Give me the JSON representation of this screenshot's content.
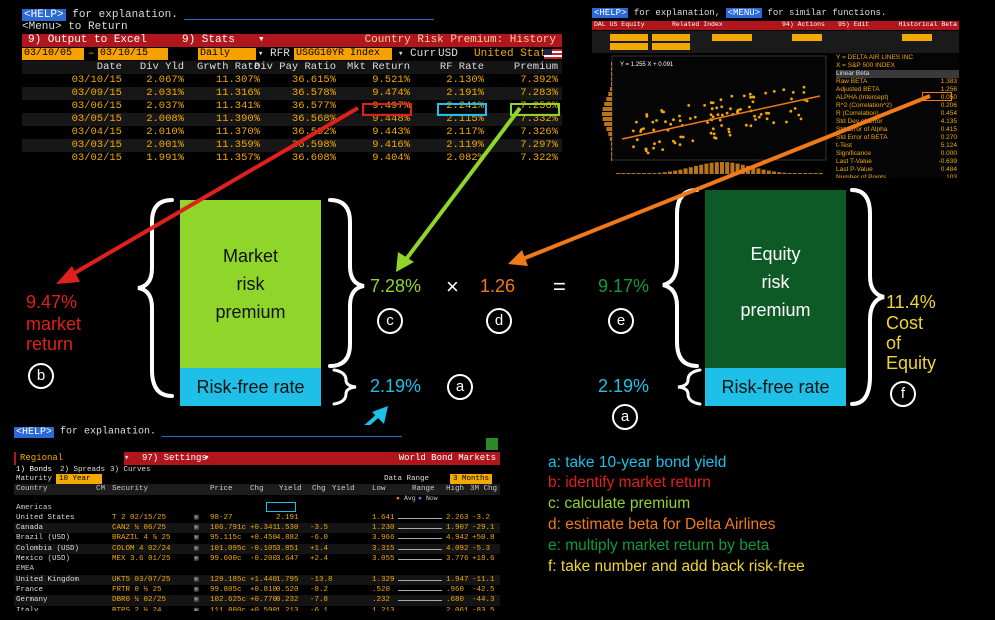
{
  "colors": {
    "accent_red": "#e0201c",
    "accent_green": "#8fd52a",
    "accent_orange": "#f07a1a",
    "accent_blue": "#1ec0e8",
    "dark_green": "#0e5a26",
    "yellow": "#f0d62c",
    "bloomberg_amber": "#f2a900"
  },
  "crp": {
    "help_key": "<HELP>",
    "help_text": "for explanation.",
    "menu_text": "<Menu> to Return",
    "output_label": "9) Output to Excel",
    "stats_label": "9) Stats",
    "title": "Country Risk Premium: History",
    "start_date": "03/10/05",
    "end_date": "03/10/15",
    "period": "Daily",
    "rfr_label": "RFR",
    "rfr_value": "USGG10YR Index",
    "curr_label": "Curr",
    "curr_value": "USD",
    "country": "United States",
    "headers": [
      "Date",
      "Div Yld",
      "Grwth Rate",
      "Div Pay Ratio",
      "Mkt Return",
      "RF Rate",
      "Premium"
    ],
    "rows": [
      [
        "03/10/15",
        "2.067%",
        "11.307%",
        "36.615%",
        "9.521%",
        "2.130%",
        "7.392%"
      ],
      [
        "03/09/15",
        "2.031%",
        "11.316%",
        "36.578%",
        "9.474%",
        "2.191%",
        "7.283%"
      ],
      [
        "03/06/15",
        "2.037%",
        "11.341%",
        "36.577%",
        "9.497%",
        "2.241%",
        "7.256%"
      ],
      [
        "03/05/15",
        "2.008%",
        "11.390%",
        "36.568%",
        "9.448%",
        "2.115%",
        "7.332%"
      ],
      [
        "03/04/15",
        "2.010%",
        "11.370%",
        "36.592%",
        "9.443%",
        "2.117%",
        "7.326%"
      ],
      [
        "03/03/15",
        "2.001%",
        "11.359%",
        "36.598%",
        "9.416%",
        "2.119%",
        "7.297%"
      ],
      [
        "03/02/15",
        "1.991%",
        "11.357%",
        "36.608%",
        "9.404%",
        "2.082%",
        "7.322%"
      ]
    ]
  },
  "reg": {
    "help_key": "<HELP>",
    "help_text": "for explanation,",
    "menu_key": "<MENU>",
    "menu_text": "for similar functions.",
    "equity_label": "DAL US Equity",
    "related_label": "Related Index",
    "actions_label": "94) Actions",
    "edit_label": "95) Edit",
    "hist_label": "Historical Beta",
    "y_series": "Y = DELTA AIR LINES INC",
    "x_series": "X = S&P 500 INDEX",
    "eq_text": "Y = 1.255 X + 0.091",
    "stat_header": "Linear Beta",
    "stats": [
      [
        "Raw BETA",
        "1.383"
      ],
      [
        "Adjusted BETA",
        "1.256"
      ],
      [
        "ALPHA (Intercept)",
        "0.050"
      ],
      [
        "R^2 (Correlation^2)",
        "0.206"
      ],
      [
        "R (Correlation)",
        "0.454"
      ],
      [
        "Std Dev of Error",
        "4.135"
      ],
      [
        "Std Error of Alpha",
        "0.415"
      ],
      [
        "Std Error of BETA",
        "0.270"
      ],
      [
        "t-Test",
        "5.124"
      ],
      [
        "Significance",
        "0.000"
      ],
      [
        "Last T-Value",
        "-0.639"
      ],
      [
        "Last P-Value",
        "0.484"
      ],
      [
        "Number of Points",
        "103"
      ]
    ]
  },
  "figure": {
    "market_box": "Market risk premium",
    "market_box_lines": [
      "Market",
      "risk",
      "premium"
    ],
    "rf_box": "Risk-free rate",
    "equity_box_lines": [
      "Equity",
      "risk",
      "premium"
    ],
    "premium_value": "7.28%",
    "times_sign": "×",
    "beta_value": "1.26",
    "equals_sign": "=",
    "equity_premium_value": "9.17%",
    "rf_value_left": "2.19%",
    "rf_value_right": "2.19%",
    "market_return_value": "9.47%",
    "market_return_label_1": "market",
    "market_return_label_2": "return",
    "cost_value": "11.4%",
    "cost_label_1": "Cost",
    "cost_label_2": "of",
    "cost_label_3": "Equity",
    "badges": {
      "a": "a",
      "b": "b",
      "c": "c",
      "d": "d",
      "e": "e",
      "f": "f"
    }
  },
  "bond": {
    "help_key": "<HELP>",
    "help_text": "for explanation.",
    "region": "Regional",
    "settings_label": "97) Settings",
    "title": "World Bond Markets",
    "tabs": [
      "1) Bonds",
      "2) Spreads",
      "3) Curves"
    ],
    "maturity_label": "Maturity",
    "maturity_value": "10 Year",
    "data_range_label": "Data Range",
    "data_range_value": "3 Months",
    "headers": [
      "Country",
      "CM",
      "Security",
      "Price",
      "Chg",
      "Yield",
      "Chg",
      "Yield",
      "Low",
      "Range",
      "High",
      "3M Chg"
    ],
    "legend_avg": "Avg",
    "legend_now": "Now",
    "groups": [
      {
        "name": "Americas",
        "rows": [
          [
            "United States",
            "T 2 02/15/25",
            "98-27",
            "",
            "2.191",
            "",
            "",
            "1.641",
            "2.263",
            "-3.2"
          ],
          [
            "Canada",
            "CAN2 ½ 06/25",
            "106.791c",
            "+0.341",
            "1.530",
            "-3.5",
            "",
            "1.230",
            "1.907",
            "-29.1"
          ],
          [
            "Brazil (USD)",
            "BRAZIL 4 ⅞ 25",
            "95.115c",
            "+0.450",
            "4.882",
            "-6.0",
            "",
            "3.966",
            "4.942",
            "+50.8"
          ],
          [
            "Colombia (USD)",
            "COLOM 4 02/24",
            "101.095c",
            "-0.105",
            "3.851",
            "+1.4",
            "",
            "3.315",
            "4.092",
            "-5.3"
          ],
          [
            "Mexico (USD)",
            "MEX 3.6 01/25",
            "99.600c",
            "-0.200",
            "3.647",
            "+2.4",
            "",
            "3.055",
            "3.776",
            "+18.6"
          ]
        ]
      },
      {
        "name": "EMEA",
        "rows": [
          [
            "United Kingdom",
            "UKT5 03/07/25",
            "129.185c",
            "+1.440",
            "1.795",
            "-13.8",
            "",
            "1.329",
            "1.947",
            "-11.1"
          ],
          [
            "France",
            "FRTR 0 ½ 25",
            "99.805c",
            "+0.810",
            "0.520",
            "-8.2",
            "",
            ".520",
            ".960",
            "-42.5"
          ],
          [
            "Germany",
            "DBR0 ½ 02/25",
            "102.625c",
            "+0.770",
            "0.232",
            "-7.8",
            "",
            ".232",
            ".680",
            "-44.3"
          ],
          [
            "Italy",
            "BTPS 2 ½ 24",
            "111.800c",
            "+0.590",
            "1.213",
            "-6.1",
            "",
            "1.213",
            "2.061",
            "-83.5"
          ]
        ]
      }
    ]
  },
  "legend": {
    "a": "a: take 10-year bond yield",
    "b": "b: identify market return",
    "c": "c: calculate premium",
    "d": "d: estimate beta for Delta Airlines",
    "e": "e: multiply market return by beta",
    "f": "f: take number and add back risk-free"
  }
}
